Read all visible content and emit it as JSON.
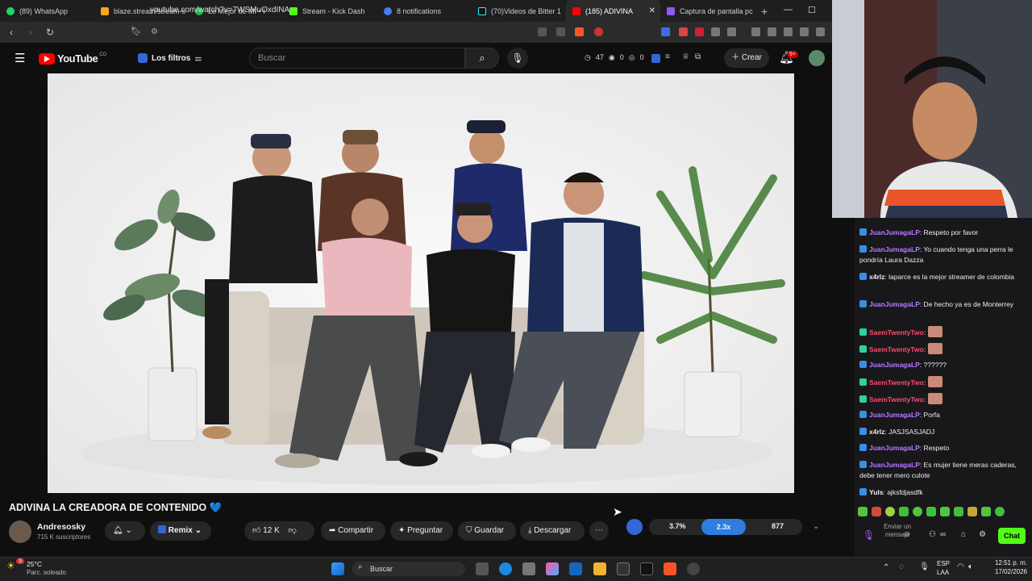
{
  "browser": {
    "tabs": [
      {
        "label": "(89) WhatsApp",
        "color": "#25d366"
      },
      {
        "label": "blaze.stream/stream-s",
        "color": "#f5a623"
      },
      {
        "label": "Lo Mejor de Mí • I",
        "color": "#1db954"
      },
      {
        "label": "Stream - Kick Dash",
        "color": "#53fc18"
      },
      {
        "label": "8 notifications",
        "color": "#4a7cf7"
      },
      {
        "label": "(70)Videos de Bitter 1",
        "color": "#111111"
      },
      {
        "label": "(185) ADIVINA",
        "color": "#ff0000"
      },
      {
        "label": "Captura de pantalla pc",
        "color": "#8a5cf5"
      }
    ],
    "active_tab_index": 6,
    "url": "youtube.com/watch?v=7WSMuOxdINA"
  },
  "youtube": {
    "logo_text": "YouTube",
    "logo_sup": "CO",
    "filters_label": "Los filtros",
    "search_placeholder": "Buscar",
    "stats": {
      "views": "47",
      "eye_a": "0",
      "eye_b": "0"
    },
    "create_label": "Crear",
    "notif_count": "9+",
    "video_title": "ADIVINA LA CREADORA DE CONTENIDO 💙",
    "channel_name": "Andresosky",
    "subscribers": "715 K suscriptores",
    "remix_label": "Remix",
    "likes": "12 K",
    "share_label": "Compartir",
    "ask_label": "Preguntar",
    "save_label": "Guardar",
    "download_label": "Descargar",
    "ext_stats": {
      "a": "3.7%",
      "b": "2.3x",
      "c": "877"
    }
  },
  "chat": {
    "messages": [
      {
        "user": "JuanJumagaLP",
        "text": ": Respeto por favor",
        "color": "#b77bff"
      },
      {
        "user": "JuanJumagaLP",
        "text": ": Yo cuando tenga una perra le pondría Laura Dazza",
        "color": "#b77bff"
      },
      {
        "user": "x4rlz",
        "text": ": laparce es la mejor streamer de colombia",
        "color": "#eeeeee"
      },
      {
        "user": "JuanJumagaLP",
        "text": ": De hecho ya es de Monterrey",
        "color": "#b77bff"
      },
      {
        "user": "SaemTwentyTwo",
        "text": ":",
        "color": "#ff4a6b",
        "emote": true
      },
      {
        "user": "SaemTwentyTwo",
        "text": ":",
        "color": "#ff4a6b",
        "emote": true
      },
      {
        "user": "JuanJumagaLP",
        "text": ": ??????",
        "color": "#b77bff"
      },
      {
        "user": "SaemTwentyTwo",
        "text": ":",
        "color": "#ff4a6b",
        "emote": true
      },
      {
        "user": "SaemTwentyTwo",
        "text": ":",
        "color": "#ff4a6b",
        "emote": true
      },
      {
        "user": "JuanJumagaLP",
        "text": ": Porfa",
        "color": "#b77bff"
      },
      {
        "user": "x4rlz",
        "text": ": JASJSASJADJ",
        "color": "#eeeeee"
      },
      {
        "user": "JuanJumagaLP",
        "text": ": Respeto",
        "color": "#b77bff"
      },
      {
        "user": "JuanJumagaLP",
        "text": ": Es mujer tiene meras caderas, debe tener mero culote",
        "color": "#b77bff"
      },
      {
        "user": "Yuls",
        "text": ": ajksfdjasdfk",
        "color": "#eeeeee"
      }
    ],
    "input_placeholder": "Enviar un mensaje",
    "chat_button": "Chat"
  },
  "taskbar": {
    "weather_temp": "25°C",
    "weather_desc": "Parc. soleado",
    "search_label": "Buscar",
    "lang": "ESP",
    "lang_sub": "LAA",
    "time": "12:51 p. m.",
    "date": "17/02/2026",
    "weather_badge": "3"
  }
}
